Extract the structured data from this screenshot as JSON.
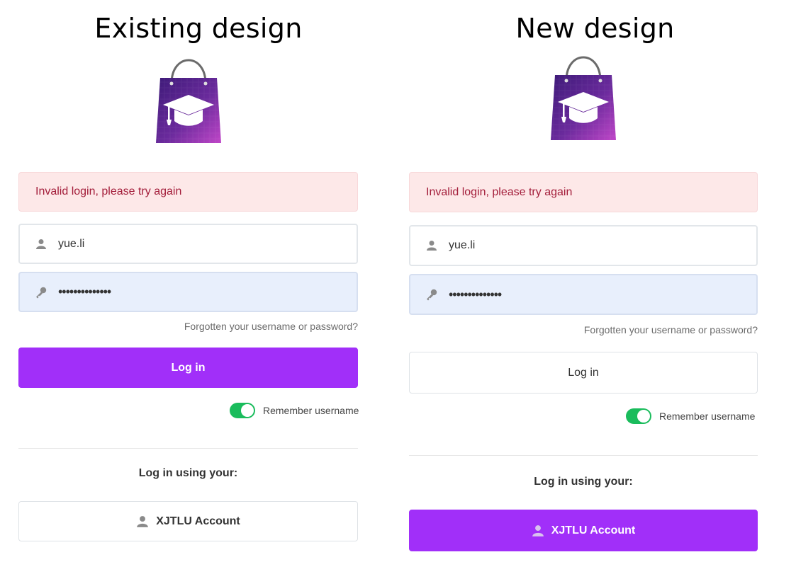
{
  "colors": {
    "primary": "#a12ff9",
    "alert_bg": "#fde8e8",
    "alert_text": "#a31d3a",
    "toggle_on": "#1abc5c",
    "password_bg": "#e8effc"
  },
  "existing": {
    "heading": "Existing design",
    "logo_icon": "shopping-bag-graduation-cap-icon",
    "alert": "Invalid login, please try again",
    "username": {
      "value": "yue.li",
      "icon": "user-icon"
    },
    "password": {
      "value": "••••••••••••••",
      "icon": "key-icon"
    },
    "forgot_link": "Forgotten your username or password?",
    "login_button": "Log in",
    "remember": {
      "label": "Remember username",
      "on": true
    },
    "login_using": "Log in using your:",
    "sso_button": {
      "label": "XJTLU Account",
      "icon": "user-icon"
    }
  },
  "new": {
    "heading": "New design",
    "logo_icon": "shopping-bag-graduation-cap-icon",
    "alert": "Invalid login, please try again",
    "username": {
      "value": "yue.li",
      "icon": "user-icon"
    },
    "password": {
      "value": "••••••••••••••",
      "icon": "key-icon"
    },
    "forgot_link": "Forgotten your username or password?",
    "login_button": "Log in",
    "remember": {
      "label": "Remember username",
      "on": true
    },
    "login_using": "Log in using your:",
    "sso_button": {
      "label": "XJTLU Account",
      "icon": "user-icon"
    }
  }
}
